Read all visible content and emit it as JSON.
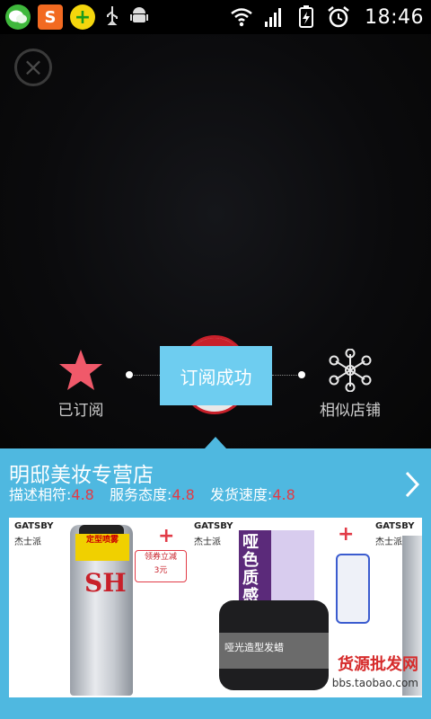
{
  "status_bar": {
    "apps": [
      "wechat-icon",
      "sogou-icon",
      "360-security-icon",
      "usb-icon",
      "android-icon"
    ],
    "sogou_glyph": "S",
    "plus_glyph": "+",
    "time": "18:46"
  },
  "hero": {
    "close_glyph": "×",
    "favorite_label": "已订阅",
    "similar_label": "相似店铺",
    "toast": "订阅成功"
  },
  "shop": {
    "name": "明邸美妆专营店",
    "ratings": [
      {
        "label": "描述相符:",
        "score": "4.8"
      },
      {
        "label": "服务态度:",
        "score": "4.8"
      },
      {
        "label": "发货速度:",
        "score": "4.8"
      }
    ]
  },
  "banner": {
    "brand_en": "GATSBY",
    "brand_cn": "杰士派",
    "spray_tag": "定型喷雾",
    "spray_mark": "SH",
    "coupon_line1": "领券立减",
    "coupon_line2": "3元",
    "wax_box_text": "哑色质感",
    "wax_jar_text": "哑光造型发蜡",
    "watermark_cn": "货源批发网",
    "watermark_url": "bbs.taobao.com"
  },
  "colors": {
    "panel": "#4fb8e0",
    "toast": "#6ecdf0",
    "score": "#e23b47",
    "star": "#f0596a"
  }
}
